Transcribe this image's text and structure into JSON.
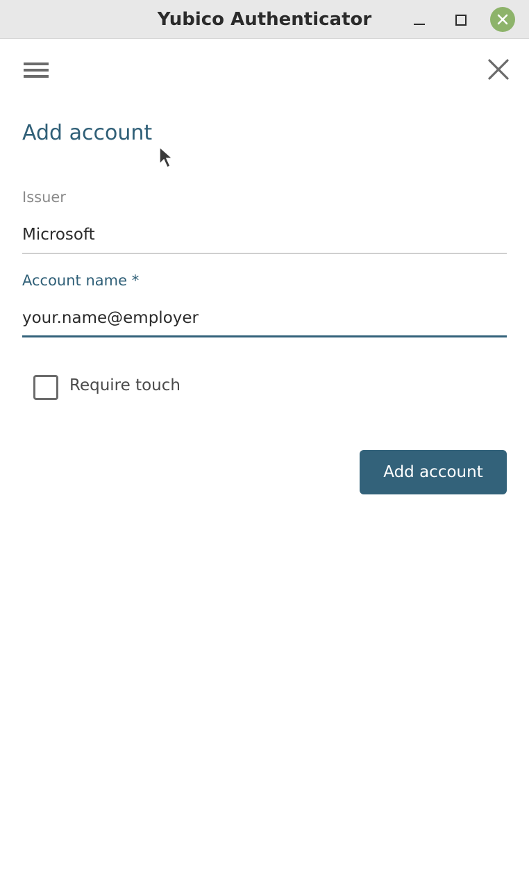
{
  "window": {
    "title": "Yubico Authenticator"
  },
  "toolbar": {
    "menu_icon": "hamburger-menu-icon",
    "close_icon": "close-icon"
  },
  "form": {
    "title": "Add account",
    "issuer": {
      "label": "Issuer",
      "value": "Microsoft"
    },
    "account_name": {
      "label": "Account name *",
      "value": "your.name@employer"
    },
    "require_touch": {
      "label": "Require touch",
      "checked": false
    },
    "submit_label": "Add account"
  },
  "colors": {
    "accent": "#33627a",
    "title_text": "#2f5f77",
    "titlebar_bg": "#e8e8e8",
    "window_close_bg": "#8db36a"
  }
}
